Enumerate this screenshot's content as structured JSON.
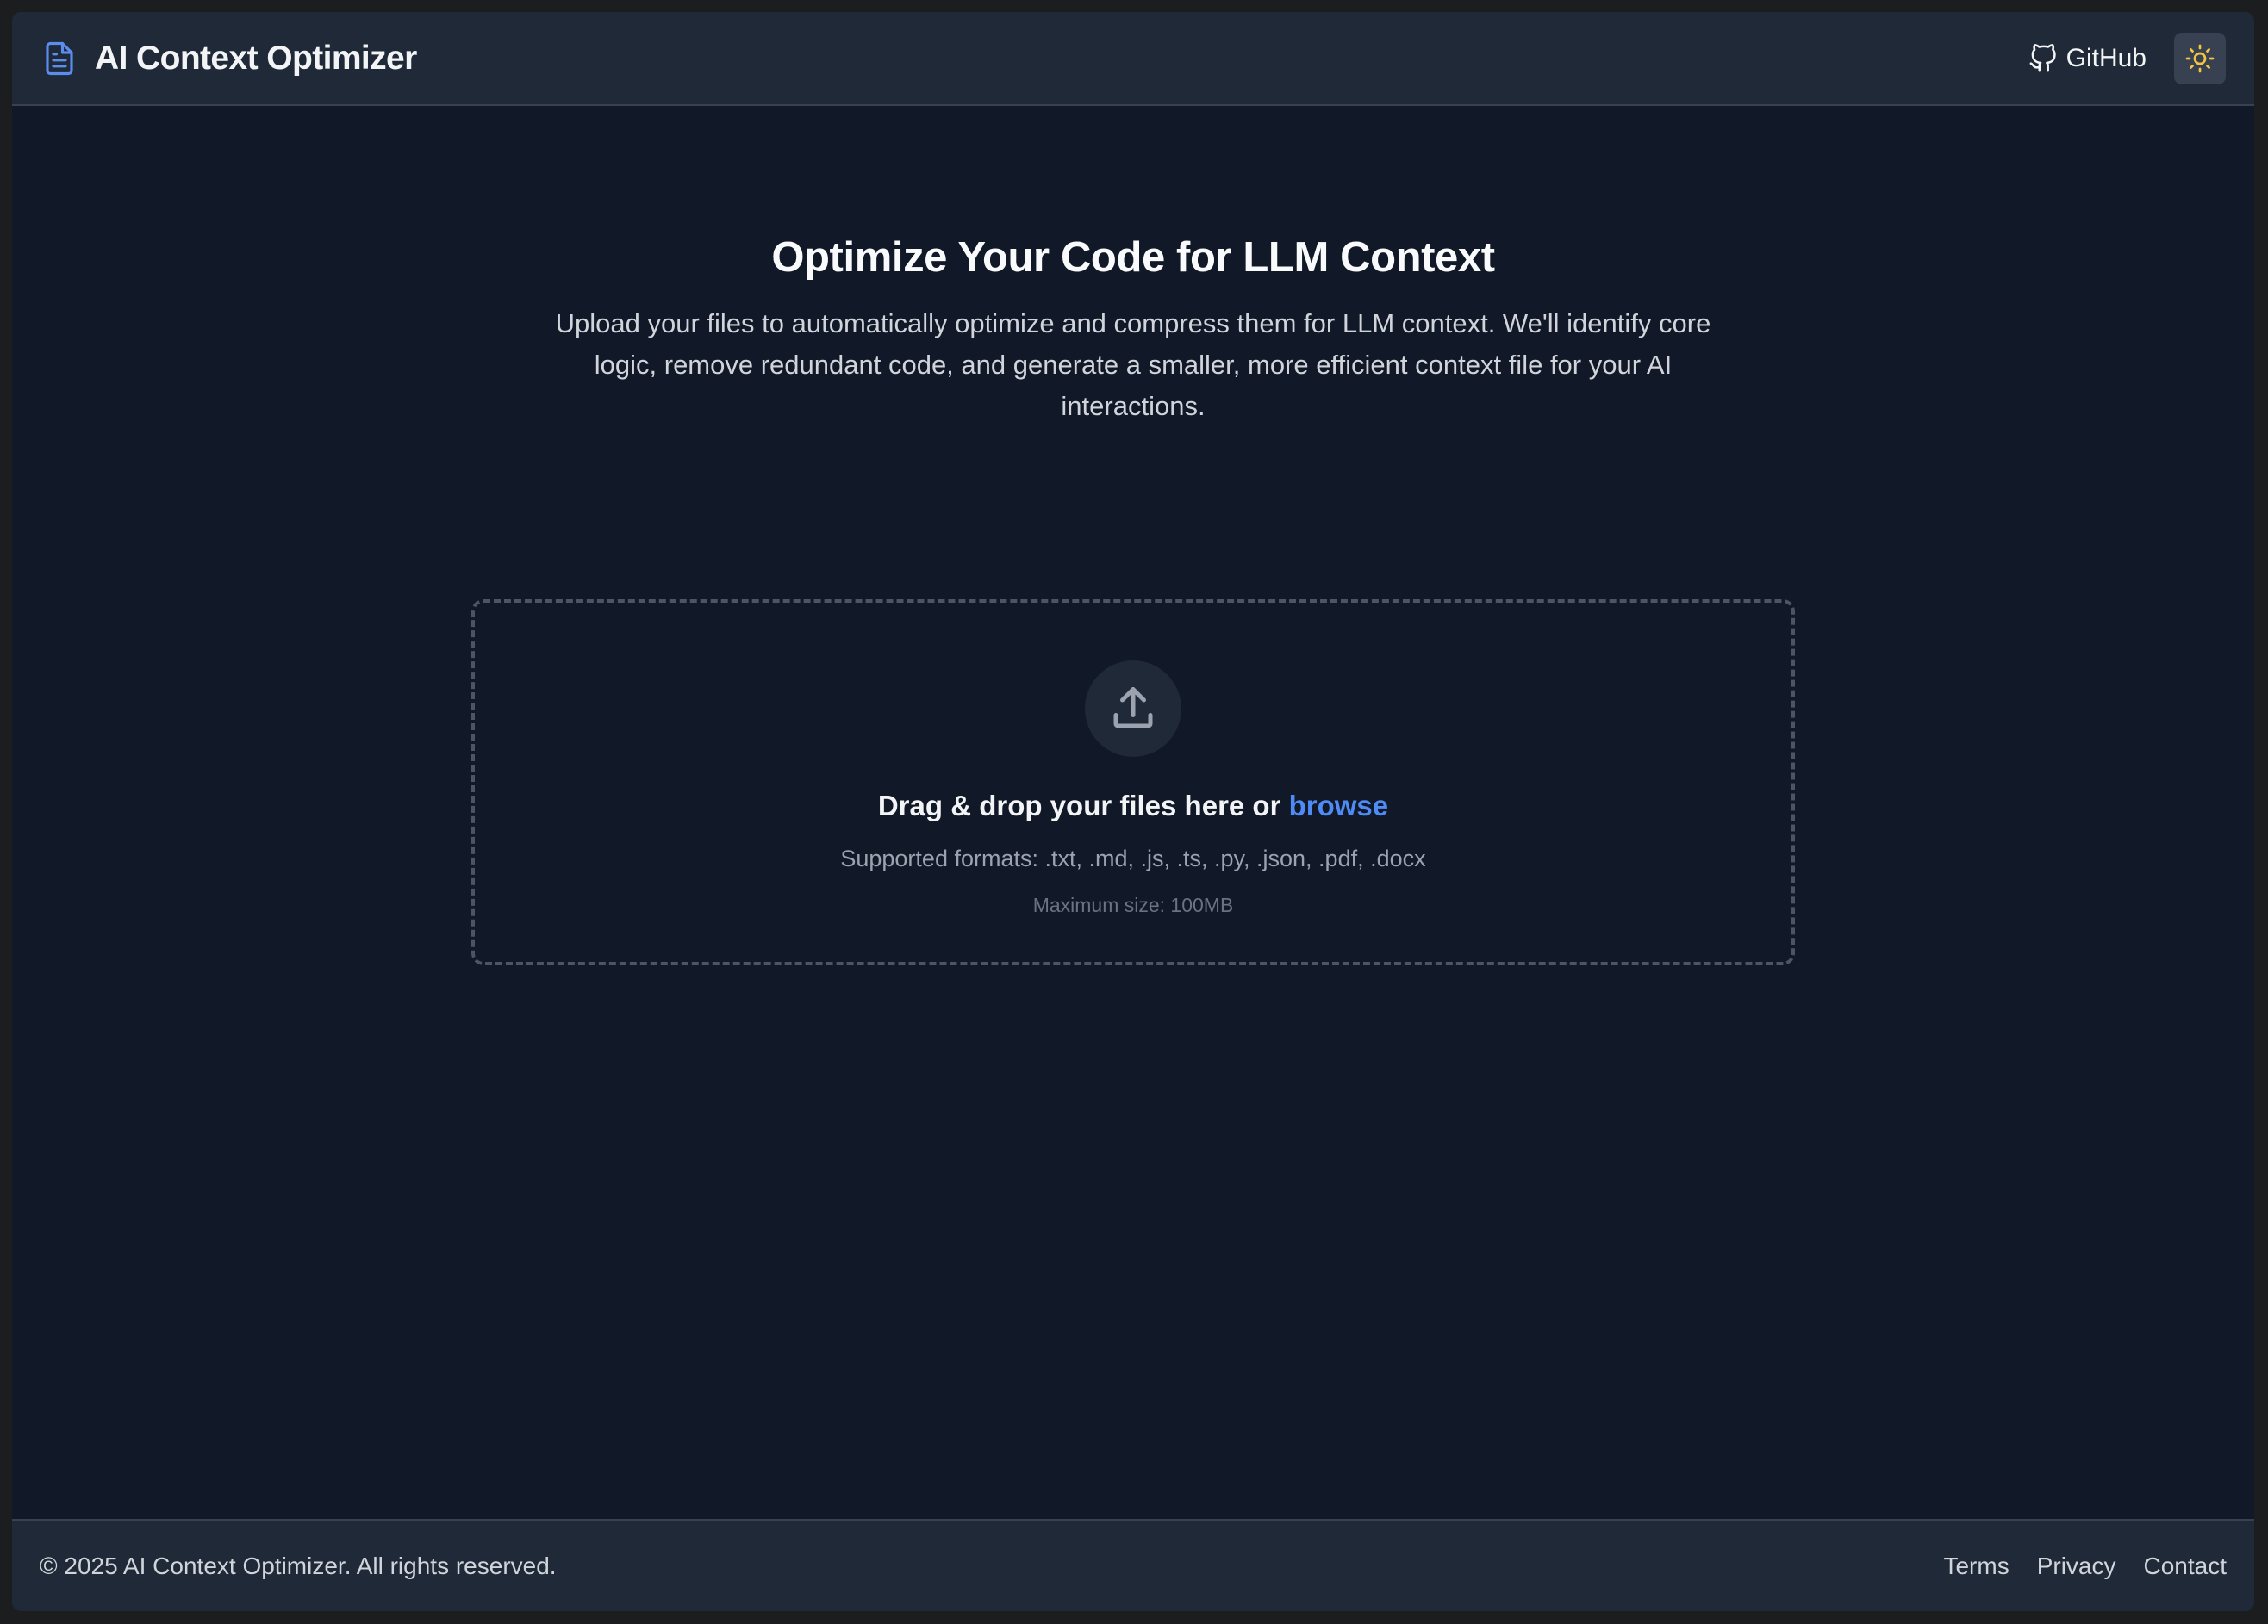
{
  "header": {
    "title": "AI Context Optimizer",
    "github_label": "GitHub",
    "brand_icon": "document-icon",
    "theme_icon": "sun-icon"
  },
  "hero": {
    "title": "Optimize Your Code for LLM Context",
    "description": "Upload your files to automatically optimize and compress them for LLM context. We'll identify core logic, remove redundant code, and generate a smaller, more efficient context file for your AI interactions."
  },
  "dropzone": {
    "prompt": "Drag & drop your files here or",
    "browse_label": "browse",
    "formats": "Supported formats: .txt, .md, .js, .ts, .py, .json, .pdf, .docx",
    "max_size": "Maximum size: 100MB",
    "icon": "upload-icon"
  },
  "footer": {
    "copyright": "© 2025 AI Context Optimizer. All rights reserved.",
    "links": [
      "Terms",
      "Privacy",
      "Contact"
    ]
  },
  "colors": {
    "background": "#111827",
    "surface": "#1f2937",
    "accent": "#4f8bf5",
    "sun": "#f5c542"
  }
}
